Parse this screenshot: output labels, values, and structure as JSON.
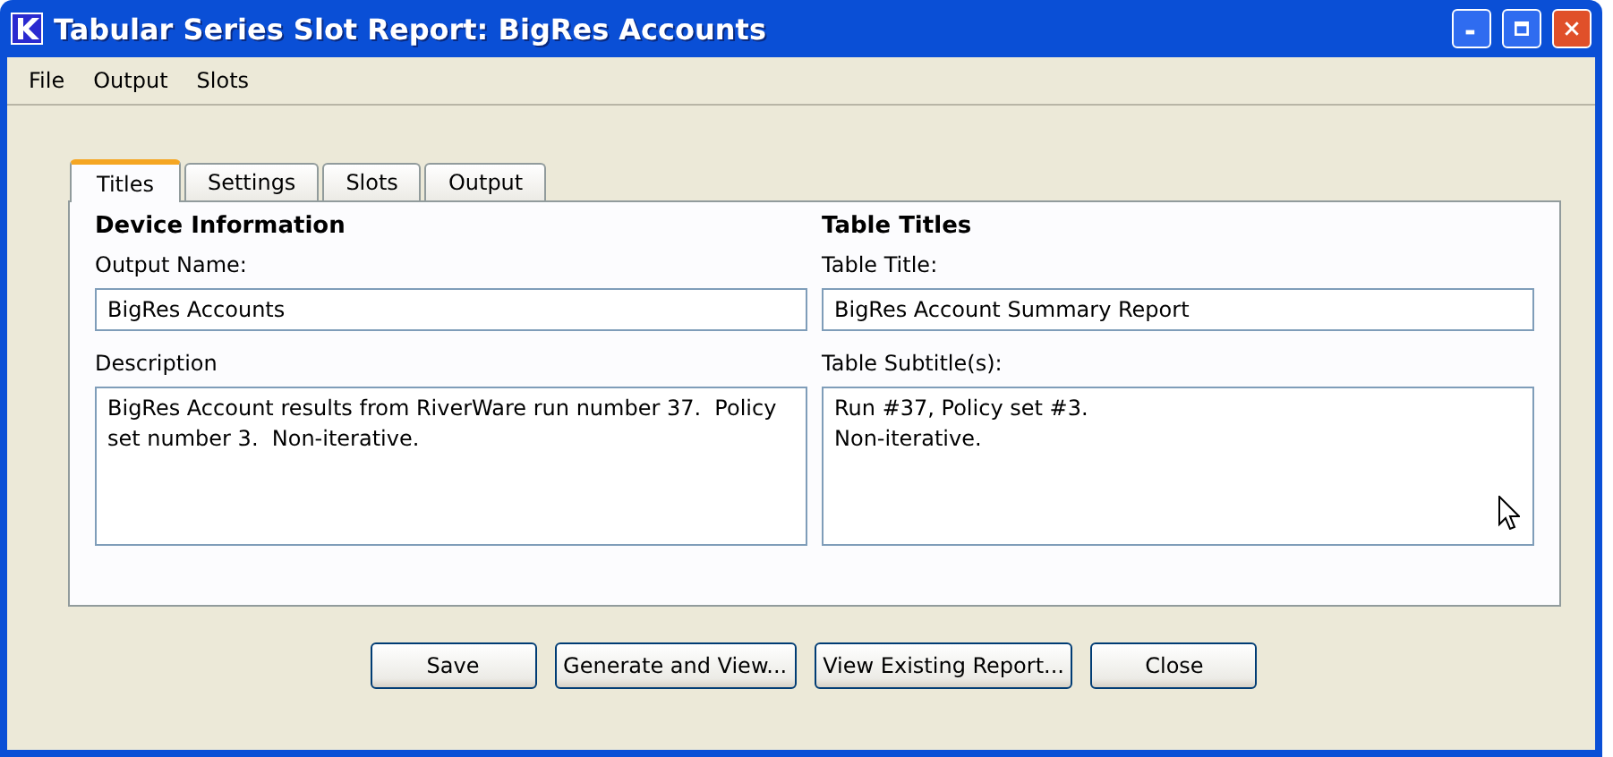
{
  "window": {
    "title": "Tabular Series Slot Report: BigRes Accounts"
  },
  "menu": [
    "File",
    "Output",
    "Slots"
  ],
  "tabs": [
    {
      "label": "Titles",
      "selected": true
    },
    {
      "label": "Settings",
      "selected": false
    },
    {
      "label": "Slots",
      "selected": false
    },
    {
      "label": "Output",
      "selected": false
    }
  ],
  "sections": [
    {
      "heading": "Device Information",
      "fields": [
        {
          "kind": "line",
          "label": "Output Name:",
          "value": "BigRes Accounts"
        },
        {
          "kind": "area",
          "label": "Description",
          "value": "BigRes Account results from RiverWare run number 37.  Policy set number 3.  Non-iterative."
        }
      ]
    },
    {
      "heading": "Table Titles",
      "fields": [
        {
          "kind": "line",
          "label": "Table Title:",
          "value": "BigRes Account Summary Report"
        },
        {
          "kind": "area",
          "label": "Table Subtitle(s):",
          "value": "Run #37, Policy set #3.\nNon-iterative."
        }
      ]
    }
  ],
  "buttons": [
    "Save",
    "Generate and View...",
    "View Existing Report...",
    "Close"
  ]
}
